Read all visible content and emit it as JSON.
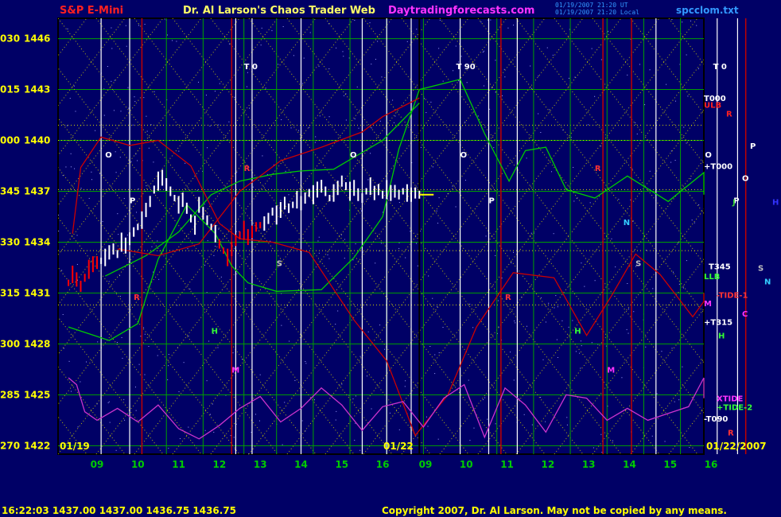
{
  "header": {
    "title_left": "S&P E-Mini",
    "title_center": "Dr. Al Larson's Chaos Trader Web",
    "title_site": "Daytradingforecasts.com",
    "timestamp_1": "01/19/2007 21:20 UT",
    "timestamp_2": "01/19/2007 21:20 Local",
    "filename": "spcclom.txt"
  },
  "footer": {
    "quote": "16:22:03  1437.00  1437.00  1436.75  1436.75",
    "copyright": "Copyright 2007, Dr. Al Larson. May not be copied by any means.",
    "date_left": "01/19",
    "date_mid": "01/22",
    "date_right": "01/22/2007"
  },
  "colors": {
    "background": "#000066",
    "plot_border": "#000000",
    "grid_yellow": "#d8d800",
    "grid_green": "#00a000",
    "vline_white": "#ffffff",
    "vline_red": "#c00000",
    "price_white": "#ffffff",
    "price_red": "#ff0000",
    "curve_green": "#00cc00",
    "curve_red": "#cc0000",
    "curve_magenta": "#cc33cc",
    "axis_green": "#00cc00",
    "axis_yellow": "#ffff00",
    "title_red": "#ff2020",
    "title_magenta": "#ff33ff",
    "title_blue": "#3399ff"
  },
  "chart_data": {
    "type": "line",
    "y_ticks": [
      {
        "left": "030",
        "price": 1446
      },
      {
        "left": "015",
        "price": 1443
      },
      {
        "left": "000",
        "price": 1440
      },
      {
        "left": "345",
        "price": 1437
      },
      {
        "left": "330",
        "price": 1434
      },
      {
        "left": "315",
        "price": 1431
      },
      {
        "left": "300",
        "price": 1428
      },
      {
        "left": "285",
        "price": 1425
      },
      {
        "left": "270",
        "price": 1422
      }
    ],
    "ylim": [
      1421.5,
      1447.2
    ],
    "x_ticks": [
      "09",
      "10",
      "11",
      "12",
      "13",
      "14",
      "15",
      "16",
      "09",
      "10",
      "11",
      "12",
      "13",
      "14",
      "15",
      "16"
    ],
    "price_bars_white": [
      [
        0.1,
        1432.9
      ],
      [
        0.2,
        1433.1
      ],
      [
        0.3,
        1433.4
      ],
      [
        0.4,
        1433.6
      ],
      [
        0.5,
        1433.3
      ],
      [
        0.6,
        1434.0
      ],
      [
        0.7,
        1433.8
      ],
      [
        0.8,
        1434.2
      ],
      [
        0.9,
        1434.6
      ],
      [
        1.0,
        1434.9
      ],
      [
        1.1,
        1435.3
      ],
      [
        1.2,
        1435.9
      ],
      [
        1.3,
        1436.4
      ],
      [
        1.4,
        1437.1
      ],
      [
        1.5,
        1437.6
      ],
      [
        1.6,
        1437.8
      ],
      [
        1.7,
        1437.4
      ],
      [
        1.8,
        1437.0
      ],
      [
        1.9,
        1436.6
      ],
      [
        2.0,
        1436.2
      ],
      [
        2.1,
        1436.5
      ],
      [
        2.2,
        1436.0
      ],
      [
        2.3,
        1435.4
      ],
      [
        2.4,
        1435.0
      ],
      [
        2.5,
        1436.2
      ],
      [
        2.6,
        1435.7
      ],
      [
        2.7,
        1435.3
      ],
      [
        2.8,
        1434.9
      ],
      [
        2.9,
        1434.5
      ],
      [
        4.1,
        1435.1
      ],
      [
        4.2,
        1435.4
      ],
      [
        4.3,
        1435.8
      ],
      [
        4.4,
        1435.6
      ],
      [
        4.5,
        1435.9
      ],
      [
        4.6,
        1436.3
      ],
      [
        4.7,
        1436.0
      ],
      [
        4.8,
        1436.2
      ],
      [
        4.9,
        1436.5
      ],
      [
        5.0,
        1436.3
      ],
      [
        5.1,
        1436.6
      ],
      [
        5.2,
        1436.9
      ],
      [
        5.3,
        1436.8
      ],
      [
        5.4,
        1437.1
      ],
      [
        5.5,
        1437.3
      ],
      [
        5.6,
        1437.0
      ],
      [
        5.7,
        1436.6
      ],
      [
        5.8,
        1436.9
      ],
      [
        5.9,
        1437.2
      ],
      [
        6.0,
        1437.6
      ],
      [
        6.1,
        1437.3
      ],
      [
        6.2,
        1437.0
      ],
      [
        6.3,
        1437.2
      ],
      [
        6.4,
        1436.8
      ],
      [
        6.5,
        1436.6
      ],
      [
        6.6,
        1437.0
      ],
      [
        6.7,
        1437.3
      ],
      [
        6.8,
        1436.9
      ],
      [
        6.9,
        1437.1
      ],
      [
        7.0,
        1436.8
      ],
      [
        7.1,
        1437.1
      ],
      [
        7.2,
        1436.9
      ],
      [
        7.3,
        1437.0
      ],
      [
        7.4,
        1436.8
      ],
      [
        7.5,
        1437.0
      ],
      [
        7.6,
        1436.9
      ],
      [
        7.7,
        1436.8
      ],
      [
        7.8,
        1436.9
      ],
      [
        7.9,
        1436.8
      ]
    ],
    "price_bars_red": [
      [
        -0.7,
        1431.6
      ],
      [
        -0.6,
        1432.1
      ],
      [
        -0.5,
        1431.8
      ],
      [
        -0.4,
        1431.4
      ],
      [
        -0.3,
        1431.9
      ],
      [
        -0.2,
        1432.4
      ],
      [
        -0.1,
        1432.7
      ],
      [
        0.0,
        1432.8
      ],
      [
        3.0,
        1433.9
      ],
      [
        3.1,
        1433.5
      ],
      [
        3.2,
        1433.1
      ],
      [
        3.3,
        1433.6
      ],
      [
        3.4,
        1434.1
      ],
      [
        3.5,
        1434.4
      ],
      [
        3.6,
        1434.7
      ],
      [
        3.7,
        1434.3
      ],
      [
        3.8,
        1434.6
      ],
      [
        3.9,
        1434.9
      ],
      [
        4.0,
        1435.0
      ]
    ],
    "series": [
      {
        "color": "curve_green",
        "points": [
          [
            -0.7,
            1429.0
          ],
          [
            0.3,
            1428.2
          ],
          [
            1.0,
            1429.2
          ],
          [
            1.5,
            1433.0
          ],
          [
            2.2,
            1436.2
          ],
          [
            2.9,
            1434.5
          ],
          [
            3.3,
            1432.6
          ],
          [
            3.7,
            1431.6
          ],
          [
            4.4,
            1431.1
          ],
          [
            5.5,
            1431.2
          ],
          [
            6.3,
            1433.1
          ],
          [
            7.0,
            1435.5
          ],
          [
            7.4,
            1439.5
          ],
          [
            7.9,
            1443.0
          ],
          [
            8.9,
            1443.6
          ],
          [
            9.5,
            1440.4
          ],
          [
            10.1,
            1437.6
          ],
          [
            10.5,
            1439.4
          ],
          [
            11.0,
            1439.6
          ],
          [
            11.5,
            1437.1
          ],
          [
            12.2,
            1436.6
          ],
          [
            13.0,
            1437.9
          ],
          [
            14.0,
            1436.4
          ],
          [
            15.0,
            1438.1
          ],
          [
            15.5,
            1438.0
          ],
          [
            16.1,
            1436.8
          ]
        ]
      },
      {
        "color": "curve_green",
        "points": [
          [
            0.2,
            1432.0
          ],
          [
            1.2,
            1433.2
          ],
          [
            2.0,
            1434.6
          ],
          [
            2.8,
            1436.8
          ],
          [
            3.5,
            1437.6
          ],
          [
            4.3,
            1438.0
          ],
          [
            5.0,
            1438.2
          ],
          [
            5.8,
            1438.3
          ],
          [
            7.0,
            1440.0
          ],
          [
            7.9,
            1442.2
          ]
        ]
      },
      {
        "color": "curve_red",
        "points": [
          [
            -0.6,
            1434.5
          ],
          [
            -0.4,
            1438.4
          ],
          [
            0.1,
            1440.2
          ],
          [
            0.8,
            1439.7
          ],
          [
            1.5,
            1440.0
          ],
          [
            2.3,
            1438.5
          ],
          [
            3.0,
            1435.1
          ],
          [
            3.5,
            1434.2
          ],
          [
            4.3,
            1434.0
          ],
          [
            5.2,
            1433.4
          ],
          [
            6.3,
            1429.4
          ],
          [
            7.1,
            1427.0
          ],
          [
            7.8,
            1422.6
          ],
          [
            8.6,
            1425.0
          ],
          [
            9.3,
            1429.0
          ],
          [
            10.2,
            1432.2
          ],
          [
            11.2,
            1431.9
          ],
          [
            12.0,
            1428.5
          ],
          [
            12.6,
            1430.8
          ],
          [
            13.2,
            1433.3
          ],
          [
            13.8,
            1432.1
          ],
          [
            14.6,
            1429.6
          ],
          [
            15.3,
            1430.5
          ],
          [
            16.1,
            1431.0
          ]
        ]
      },
      {
        "color": "curve_red",
        "points": [
          [
            0.5,
            1433.6
          ],
          [
            1.5,
            1433.2
          ],
          [
            2.5,
            1433.9
          ],
          [
            3.5,
            1437.0
          ],
          [
            4.5,
            1438.8
          ],
          [
            5.5,
            1439.6
          ],
          [
            6.5,
            1440.5
          ],
          [
            7.0,
            1441.4
          ],
          [
            7.9,
            1442.5
          ]
        ]
      },
      {
        "color": "curve_magenta",
        "points": [
          [
            -0.7,
            1426.0
          ],
          [
            -0.5,
            1425.6
          ],
          [
            -0.3,
            1424.0
          ],
          [
            0.0,
            1423.5
          ],
          [
            0.5,
            1424.2
          ],
          [
            1.0,
            1423.4
          ],
          [
            1.5,
            1424.4
          ],
          [
            2.0,
            1423.0
          ],
          [
            2.5,
            1422.4
          ],
          [
            3.0,
            1423.2
          ],
          [
            3.5,
            1424.2
          ],
          [
            4.0,
            1424.9
          ],
          [
            4.5,
            1423.4
          ],
          [
            5.0,
            1424.2
          ],
          [
            5.5,
            1425.4
          ],
          [
            6.0,
            1424.4
          ],
          [
            6.5,
            1422.9
          ],
          [
            7.0,
            1424.3
          ],
          [
            7.5,
            1424.6
          ],
          [
            8.0,
            1423.1
          ],
          [
            8.5,
            1424.8
          ],
          [
            9.0,
            1425.6
          ],
          [
            9.5,
            1422.5
          ],
          [
            10.0,
            1425.4
          ],
          [
            10.5,
            1424.4
          ],
          [
            11.0,
            1422.8
          ],
          [
            11.5,
            1425.0
          ],
          [
            12.0,
            1424.8
          ],
          [
            12.5,
            1423.5
          ],
          [
            13.0,
            1424.2
          ],
          [
            13.5,
            1423.5
          ],
          [
            14.0,
            1423.9
          ],
          [
            14.5,
            1424.3
          ],
          [
            15.0,
            1426.0
          ],
          [
            15.5,
            1425.0
          ],
          [
            16.1,
            1424.8
          ]
        ]
      }
    ],
    "dotted_horizontals": [
      1440.9,
      1440.0,
      1437.1,
      1433.5,
      1430.3
    ],
    "white_vlines": [
      0.1,
      0.8,
      3.4,
      3.8,
      5.0,
      6.5,
      7.1,
      7.7,
      8.9,
      9.6,
      10.3,
      13.7,
      15.2,
      15.7
    ],
    "red_vlines": [
      1.1,
      3.3,
      9.9,
      12.4,
      13.1,
      15.9
    ],
    "green_vlines": [
      0.8,
      1.7,
      2.6,
      3.6,
      4.4,
      5.3,
      6.2,
      7.1,
      8.0,
      8.9,
      9.8,
      10.7,
      11.6,
      12.5,
      13.4,
      14.3,
      15.2,
      16.1
    ],
    "panel_split_x": 7.9,
    "annotations": [
      {
        "text": "T 0",
        "x": 3.6,
        "y": 1444.2,
        "color": "#ffffff"
      },
      {
        "text": "T 90",
        "x": 8.8,
        "y": 1444.2,
        "color": "#ffffff"
      },
      {
        "text": "T 0",
        "x": 15.1,
        "y": 1444.2,
        "color": "#ffffff"
      },
      {
        "text": "O",
        "x": 0.2,
        "y": 1439.0,
        "color": "#ffffff"
      },
      {
        "text": "O",
        "x": 6.2,
        "y": 1439.0,
        "color": "#ffffff"
      },
      {
        "text": "O",
        "x": 8.9,
        "y": 1439.0,
        "color": "#ffffff"
      },
      {
        "text": "O",
        "x": 14.9,
        "y": 1439.0,
        "color": "#ffffff"
      },
      {
        "text": "P",
        "x": 0.8,
        "y": 1436.3,
        "color": "#ffffff"
      },
      {
        "text": "P",
        "x": 9.6,
        "y": 1436.3,
        "color": "#ffffff"
      },
      {
        "text": "P",
        "x": 15.6,
        "y": 1436.3,
        "color": "#ffffff"
      },
      {
        "text": "S",
        "x": 4.4,
        "y": 1432.6,
        "color": "#c0c0c0"
      },
      {
        "text": "S",
        "x": 13.2,
        "y": 1432.6,
        "color": "#c0c0c0"
      },
      {
        "text": "N",
        "x": 12.9,
        "y": 1435.0,
        "color": "#33ccff"
      },
      {
        "text": "H",
        "x": 2.8,
        "y": 1428.6,
        "color": "#33ff33"
      },
      {
        "text": "H",
        "x": 11.7,
        "y": 1428.6,
        "color": "#33ff33"
      },
      {
        "text": "M",
        "x": 3.3,
        "y": 1426.3,
        "color": "#ff33ff"
      },
      {
        "text": "M",
        "x": 12.5,
        "y": 1426.3,
        "color": "#ff33ff"
      },
      {
        "text": "R",
        "x": 0.9,
        "y": 1430.6,
        "color": "#ff3333"
      },
      {
        "text": "R",
        "x": 10.0,
        "y": 1430.6,
        "color": "#ff3333"
      },
      {
        "text": "R",
        "x": 3.6,
        "y": 1438.2,
        "color": "#ff3333"
      },
      {
        "text": "R",
        "x": 12.2,
        "y": 1438.2,
        "color": "#ff3333"
      }
    ]
  },
  "right_labels": [
    {
      "text": "T000",
      "price": 1442.5,
      "color": "#ffffff",
      "dx": 0
    },
    {
      "text": "ULB",
      "price": 1442.1,
      "color": "#ff2020",
      "dx": 0
    },
    {
      "text": "R",
      "price": 1441.6,
      "color": "#ff2020",
      "dx": 28
    },
    {
      "text": "P",
      "price": 1439.7,
      "color": "#ffffff",
      "dx": 58
    },
    {
      "text": "+T000",
      "price": 1438.5,
      "color": "#ffffff",
      "dx": 0
    },
    {
      "text": "O",
      "price": 1437.8,
      "color": "#ffffff",
      "dx": 48
    },
    {
      "text": "J",
      "price": 1436.4,
      "color": "#33cc33",
      "dx": 36
    },
    {
      "text": "H",
      "price": 1436.4,
      "color": "#3333ff",
      "dx": 86
    },
    {
      "text": "T345",
      "price": 1432.6,
      "color": "#ffffff",
      "dx": 6
    },
    {
      "text": "S",
      "price": 1432.5,
      "color": "#c0c0c0",
      "dx": 68
    },
    {
      "text": "LLB",
      "price": 1432.0,
      "color": "#33ff33",
      "dx": 0
    },
    {
      "text": "N",
      "price": 1431.7,
      "color": "#33ccff",
      "dx": 76
    },
    {
      "text": "-TIDE-1",
      "price": 1430.9,
      "color": "#ff3333",
      "dx": 16
    },
    {
      "text": "M",
      "price": 1430.4,
      "color": "#ff33ff",
      "dx": 0
    },
    {
      "text": "C",
      "price": 1429.8,
      "color": "#ff33ff",
      "dx": 48
    },
    {
      "text": "+T315",
      "price": 1429.3,
      "color": "#ffffff",
      "dx": 0
    },
    {
      "text": "H",
      "price": 1428.5,
      "color": "#33ff33",
      "dx": 18
    },
    {
      "text": "XTIDE",
      "price": 1424.8,
      "color": "#ff33ff",
      "dx": 16
    },
    {
      "text": "+TIDE-2",
      "price": 1424.3,
      "color": "#33ff33",
      "dx": 16
    },
    {
      "text": "-T090",
      "price": 1423.6,
      "color": "#ffffff",
      "dx": 0
    },
    {
      "text": "R",
      "price": 1422.8,
      "color": "#ff3333",
      "dx": 30
    }
  ]
}
